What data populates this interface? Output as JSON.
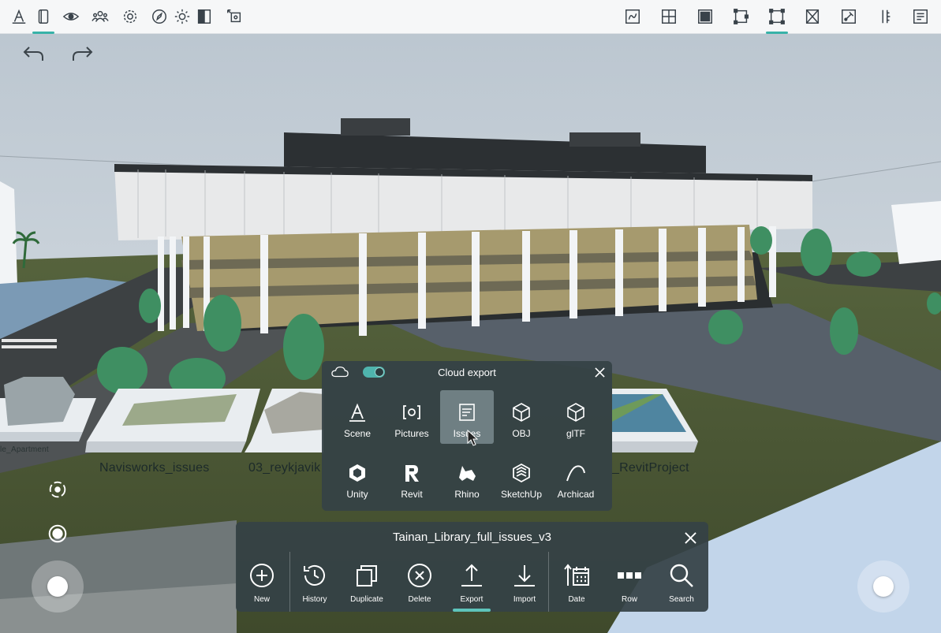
{
  "colors": {
    "accent": "#38b2a8",
    "panel_bg": "#354246",
    "selected_bg": "#6f7f83",
    "toolbar_bg": "#f6f7f8"
  },
  "top_toolbar": {
    "left_icons": [
      "annotate-icon",
      "view-mode-icon",
      "eye-icon",
      "people-icon",
      "settings-gear-icon",
      "compass-icon",
      "sun-icon",
      "section-box-icon",
      "transform-icon"
    ],
    "right_icons": [
      "sketch-icon",
      "grid-icon",
      "fill-icon",
      "clip-icon",
      "selection-frame-icon",
      "cross-box-icon",
      "pin-icon",
      "ruler-icon",
      "document-icon"
    ],
    "active_left": "view-mode-icon",
    "active_right": "selection-frame-icon"
  },
  "scene": {
    "project_cards": [
      "le_Apartment",
      "Navisworks_issues",
      "03_reykjavik",
      "_RevitProject"
    ]
  },
  "cloud_export": {
    "title": "Cloud export",
    "toggle_on": true,
    "items": [
      {
        "label": "Scene",
        "icon": "scene-icon"
      },
      {
        "label": "Pictures",
        "icon": "pictures-icon"
      },
      {
        "label": "Issues",
        "icon": "issues-icon",
        "selected": true
      },
      {
        "label": "OBJ",
        "icon": "cube-icon"
      },
      {
        "label": "glTF",
        "icon": "cube-icon"
      },
      {
        "label": "Unity",
        "icon": "unity-icon"
      },
      {
        "label": "Revit",
        "icon": "revit-icon"
      },
      {
        "label": "Rhino",
        "icon": "rhino-icon"
      },
      {
        "label": "SketchUp",
        "icon": "sketchup-icon"
      },
      {
        "label": "Archicad",
        "icon": "archicad-icon"
      }
    ]
  },
  "file_panel": {
    "title": "Tainan_Library_full_issues_v3",
    "active": "Export",
    "items": [
      {
        "label": "New",
        "icon": "plus-circle-icon"
      },
      {
        "label": "History",
        "icon": "history-icon"
      },
      {
        "label": "Duplicate",
        "icon": "duplicate-icon"
      },
      {
        "label": "Delete",
        "icon": "delete-icon"
      },
      {
        "label": "Export",
        "icon": "upload-icon"
      },
      {
        "label": "Import",
        "icon": "download-icon"
      },
      {
        "label": "Date",
        "icon": "sort-date-icon"
      },
      {
        "label": "Row",
        "icon": "row-view-icon"
      },
      {
        "label": "Search",
        "icon": "search-icon"
      }
    ]
  }
}
